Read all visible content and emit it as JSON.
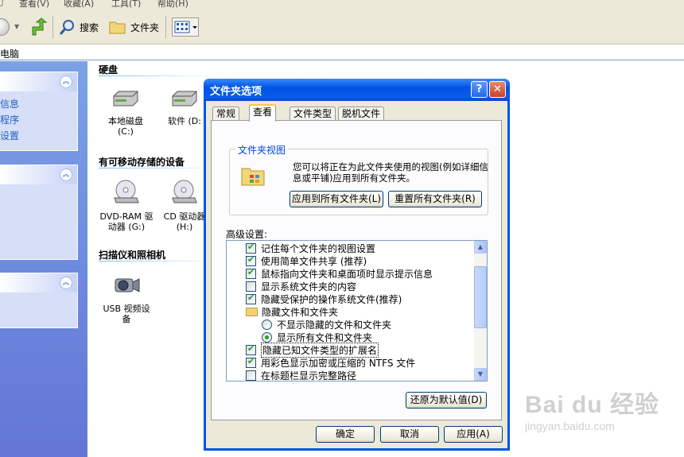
{
  "explorer": {
    "menu": [
      "查看(V)",
      "收藏(A)",
      "工具(T)",
      "帮助(H)"
    ],
    "toolbar": {
      "search_label": "搜索",
      "folders_label": "文件夹"
    },
    "address": "电脑",
    "left_pane": {
      "panel1_links": [
        "信息",
        "程序",
        "设置"
      ]
    },
    "groups": {
      "hard_disks": "硬盘",
      "removable": "有可移动存储的设备",
      "scanners": "扫描仪和照相机"
    },
    "items": {
      "local_disk_line1": "本地磁盘",
      "local_disk_line2": "(C:)",
      "software_disk": "软件 (D:",
      "dvd_line1": "DVD-RAM 驱",
      "dvd_line2": "动器 (G:)",
      "cd_line1": "CD 驱动器",
      "cd_line2": "(H:)",
      "usb_line1": "USB 视频设",
      "usb_line2": "备"
    }
  },
  "dialog": {
    "title": "文件夹选项",
    "help_btn": "?",
    "close_btn": "✕",
    "tabs": [
      "常规",
      "查看",
      "文件类型",
      "脱机文件"
    ],
    "active_tab": "查看",
    "folder_views": {
      "legend": "文件夹视图",
      "description": "您可以将正在为此文件夹使用的视图(例如详细信息或平铺)应用到所有文件夹。",
      "apply_all": "应用到所有文件夹(L)",
      "reset_all": "重置所有文件夹(R)"
    },
    "advanced_label": "高级设置:",
    "settings": [
      {
        "type": "checkbox",
        "checked": true,
        "label": "记住每个文件夹的视图设置"
      },
      {
        "type": "checkbox",
        "checked": true,
        "label": "使用简单文件共享 (推荐)"
      },
      {
        "type": "checkbox",
        "checked": true,
        "label": "鼠标指向文件夹和桌面项时显示提示信息"
      },
      {
        "type": "checkbox",
        "checked": false,
        "label": "显示系统文件夹的内容"
      },
      {
        "type": "checkbox",
        "checked": true,
        "label": "隐藏受保护的操作系统文件(推荐)"
      },
      {
        "type": "folder",
        "label": "隐藏文件和文件夹"
      },
      {
        "type": "radio",
        "checked": false,
        "label": "不显示隐藏的文件和文件夹"
      },
      {
        "type": "radio",
        "checked": true,
        "label": "显示所有文件和文件夹"
      },
      {
        "type": "checkbox",
        "checked": true,
        "label": "隐藏已知文件类型的扩展名",
        "focused": true
      },
      {
        "type": "checkbox",
        "checked": true,
        "label": "用彩色显示加密或压缩的 NTFS 文件"
      },
      {
        "type": "checkbox",
        "checked": false,
        "label": "在标题栏显示完整路径"
      }
    ],
    "restore_defaults": "还原为默认值(D)",
    "ok": "确定",
    "cancel": "取消",
    "apply": "应用(A)"
  },
  "watermark": {
    "brand": "Bai du 经验",
    "url": "jingyan.baidu.com"
  },
  "colors": {
    "title_blue": "#0054e3",
    "task_pane": "#6f8ee0",
    "legend_blue": "#0046d5",
    "check_green": "#21a121"
  }
}
